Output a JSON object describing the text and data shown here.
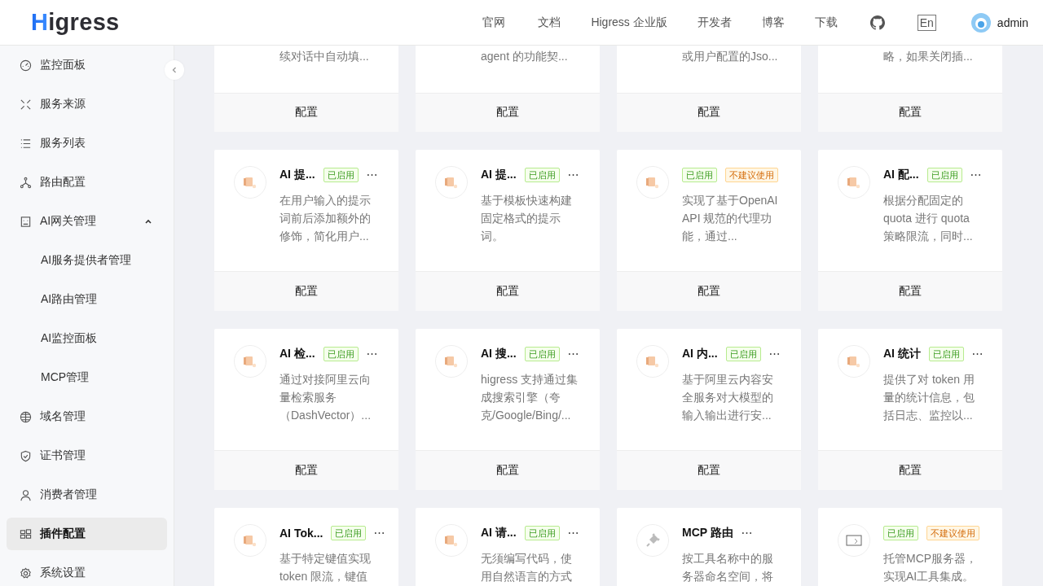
{
  "header": {
    "logo": "Higress",
    "nav": [
      "官网",
      "文档",
      "Higress 企业版",
      "开发者",
      "博客",
      "下载"
    ],
    "language": "En",
    "user": "admin"
  },
  "sidebar": {
    "items": [
      {
        "kind": "dashboard",
        "label": "监控面板",
        "selected": false
      },
      {
        "kind": "source",
        "label": "服务来源",
        "selected": false
      },
      {
        "kind": "list",
        "label": "服务列表",
        "selected": false
      },
      {
        "kind": "route",
        "label": "路由配置",
        "selected": false
      },
      {
        "kind": "ai",
        "label": "AI网关管理",
        "selected": false,
        "expanded": true,
        "children": [
          {
            "label": "AI服务提供者管理",
            "selected": false
          },
          {
            "label": "AI路由管理",
            "selected": false
          },
          {
            "label": "AI监控面板",
            "selected": false
          },
          {
            "label": "MCP管理",
            "selected": false
          }
        ]
      },
      {
        "kind": "globe",
        "label": "域名管理",
        "selected": false
      },
      {
        "kind": "shield",
        "label": "证书管理",
        "selected": false
      },
      {
        "kind": "user",
        "label": "消费者管理",
        "selected": false
      },
      {
        "kind": "plugin",
        "label": "插件配置",
        "selected": true
      },
      {
        "kind": "gear",
        "label": "系统设置",
        "selected": false
      }
    ]
  },
  "plugins": [
    {
      "kind": "partial",
      "description": "续对话中自动填...",
      "action": "配置"
    },
    {
      "kind": "partial",
      "description": "agent 的功能契...",
      "action": "配置"
    },
    {
      "kind": "partial",
      "description": "或用户配置的Jso...",
      "action": "配置"
    },
    {
      "kind": "partial",
      "description": "略，如果关闭插...",
      "action": "配置"
    },
    {
      "kind": "full",
      "title": "AI 提...",
      "badges": [
        {
          "label": "已启用",
          "kind": "enabled"
        }
      ],
      "description": "在用户输入的提示词前后添加额外的修饰，简化用户...",
      "action": "配置"
    },
    {
      "kind": "full",
      "title": "AI 提...",
      "badges": [
        {
          "label": "已启用",
          "kind": "enabled"
        }
      ],
      "description": "基于模板快速构建固定格式的提示词。",
      "action": "配置"
    },
    {
      "kind": "full",
      "badges": [
        {
          "label": "已启用",
          "kind": "enabled"
        },
        {
          "label": "不建议使用",
          "kind": "deprecated"
        }
      ],
      "description": "实现了基于OpenAI API 规范的代理功能，通过...",
      "action": "配置"
    },
    {
      "kind": "full",
      "title": "AI 配...",
      "badges": [
        {
          "label": "已启用",
          "kind": "enabled"
        }
      ],
      "description": "根据分配固定的quota 进行 quota 策略限流，同时...",
      "action": "配置"
    },
    {
      "kind": "full",
      "title": "AI 检...",
      "badges": [
        {
          "label": "已启用",
          "kind": "enabled"
        }
      ],
      "description": "通过对接阿里云向量检索服务（DashVector）...",
      "action": "配置"
    },
    {
      "kind": "full",
      "title": "AI 搜...",
      "badges": [
        {
          "label": "已启用",
          "kind": "enabled"
        }
      ],
      "description": "higress 支持通过集成搜索引擎（夸克/Google/Bing/...",
      "action": "配置"
    },
    {
      "kind": "full",
      "title": "AI 内...",
      "badges": [
        {
          "label": "已启用",
          "kind": "enabled"
        }
      ],
      "description": "基于阿里云内容安全服务对大模型的输入输出进行安...",
      "action": "配置"
    },
    {
      "kind": "full",
      "title": "AI 统计",
      "badges": [
        {
          "label": "已启用",
          "kind": "enabled"
        }
      ],
      "description": "提供了对 token 用量的统计信息，包括日志、监控以...",
      "action": "配置"
    },
    {
      "kind": "full",
      "title": "AI Tok...",
      "badges": [
        {
          "label": "已启用",
          "kind": "enabled"
        }
      ],
      "description": "基于特定键值实现token 限流，键值"
    },
    {
      "kind": "full",
      "title": "AI 请...",
      "badges": [
        {
          "label": "已启用",
          "kind": "enabled"
        }
      ],
      "description": "无须编写代码，使用自然语言的方式"
    },
    {
      "kind": "plug",
      "title": "MCP 路由",
      "description": "按工具名称中的服务器命名空间，将"
    },
    {
      "kind": "image",
      "badges": [
        {
          "label": "已启用",
          "kind": "enabled"
        },
        {
          "label": "不建议使用",
          "kind": "deprecated"
        }
      ],
      "description": "托管MCP服务器，实现AI工具集成。"
    }
  ]
}
